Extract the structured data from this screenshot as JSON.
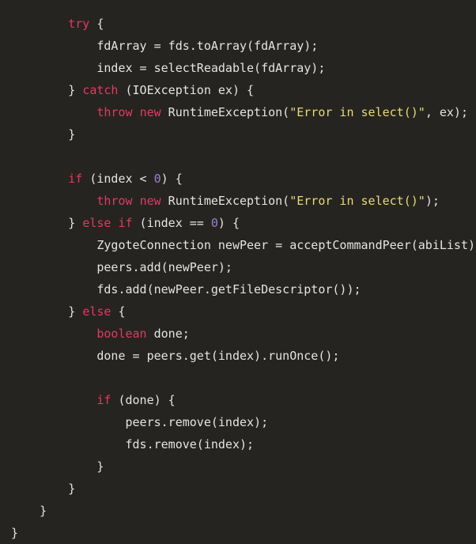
{
  "editor": {
    "language": "java",
    "background_color": "#262420",
    "foreground_color": "#e4e4e4",
    "keyword_color": "#e03a66",
    "string_color": "#e6db74",
    "number_color": "#9a7fd4",
    "font_size_px": 15,
    "line_height_px": 28,
    "indent_unit_spaces": 4
  },
  "code": {
    "lines": [
      {
        "indent": 2,
        "tokens": [
          {
            "t": "kw",
            "v": "try"
          },
          {
            "t": "plain",
            "v": " {"
          }
        ]
      },
      {
        "indent": 3,
        "tokens": [
          {
            "t": "plain",
            "v": "fdArray = fds.toArray(fdArray);"
          }
        ]
      },
      {
        "indent": 3,
        "tokens": [
          {
            "t": "plain",
            "v": "index = selectReadable(fdArray);"
          }
        ]
      },
      {
        "indent": 2,
        "tokens": [
          {
            "t": "plain",
            "v": "} "
          },
          {
            "t": "kw",
            "v": "catch"
          },
          {
            "t": "plain",
            "v": " (IOException ex) {"
          }
        ]
      },
      {
        "indent": 3,
        "tokens": [
          {
            "t": "kw",
            "v": "throw"
          },
          {
            "t": "plain",
            "v": " "
          },
          {
            "t": "kw",
            "v": "new"
          },
          {
            "t": "plain",
            "v": " RuntimeException("
          },
          {
            "t": "str",
            "v": "\"Error in select()\""
          },
          {
            "t": "plain",
            "v": ", ex);"
          }
        ]
      },
      {
        "indent": 2,
        "tokens": [
          {
            "t": "plain",
            "v": "}"
          }
        ]
      },
      {
        "indent": 0,
        "tokens": []
      },
      {
        "indent": 2,
        "tokens": [
          {
            "t": "kw",
            "v": "if"
          },
          {
            "t": "plain",
            "v": " (index < "
          },
          {
            "t": "num",
            "v": "0"
          },
          {
            "t": "plain",
            "v": ") {"
          }
        ]
      },
      {
        "indent": 3,
        "tokens": [
          {
            "t": "kw",
            "v": "throw"
          },
          {
            "t": "plain",
            "v": " "
          },
          {
            "t": "kw",
            "v": "new"
          },
          {
            "t": "plain",
            "v": " RuntimeException("
          },
          {
            "t": "str",
            "v": "\"Error in select()\""
          },
          {
            "t": "plain",
            "v": ");"
          }
        ]
      },
      {
        "indent": 2,
        "tokens": [
          {
            "t": "plain",
            "v": "} "
          },
          {
            "t": "kw",
            "v": "else"
          },
          {
            "t": "plain",
            "v": " "
          },
          {
            "t": "kw",
            "v": "if"
          },
          {
            "t": "plain",
            "v": " (index == "
          },
          {
            "t": "num",
            "v": "0"
          },
          {
            "t": "plain",
            "v": ") {"
          }
        ]
      },
      {
        "indent": 3,
        "tokens": [
          {
            "t": "plain",
            "v": "ZygoteConnection newPeer = acceptCommandPeer(abiList);"
          }
        ]
      },
      {
        "indent": 3,
        "tokens": [
          {
            "t": "plain",
            "v": "peers.add(newPeer);"
          }
        ]
      },
      {
        "indent": 3,
        "tokens": [
          {
            "t": "plain",
            "v": "fds.add(newPeer.getFileDescriptor());"
          }
        ]
      },
      {
        "indent": 2,
        "tokens": [
          {
            "t": "plain",
            "v": "} "
          },
          {
            "t": "kw",
            "v": "else"
          },
          {
            "t": "plain",
            "v": " {"
          }
        ]
      },
      {
        "indent": 3,
        "tokens": [
          {
            "t": "kw",
            "v": "boolean"
          },
          {
            "t": "plain",
            "v": " done;"
          }
        ]
      },
      {
        "indent": 3,
        "tokens": [
          {
            "t": "plain",
            "v": "done = peers.get(index).runOnce();"
          }
        ]
      },
      {
        "indent": 0,
        "tokens": []
      },
      {
        "indent": 3,
        "tokens": [
          {
            "t": "kw",
            "v": "if"
          },
          {
            "t": "plain",
            "v": " (done) {"
          }
        ]
      },
      {
        "indent": 4,
        "tokens": [
          {
            "t": "plain",
            "v": "peers.remove(index);"
          }
        ]
      },
      {
        "indent": 4,
        "tokens": [
          {
            "t": "plain",
            "v": "fds.remove(index);"
          }
        ]
      },
      {
        "indent": 3,
        "tokens": [
          {
            "t": "plain",
            "v": "}"
          }
        ]
      },
      {
        "indent": 2,
        "tokens": [
          {
            "t": "plain",
            "v": "}"
          }
        ]
      },
      {
        "indent": 1,
        "tokens": [
          {
            "t": "plain",
            "v": "}"
          }
        ]
      },
      {
        "indent": 0,
        "tokens": [
          {
            "t": "plain",
            "v": "}"
          }
        ]
      }
    ]
  }
}
